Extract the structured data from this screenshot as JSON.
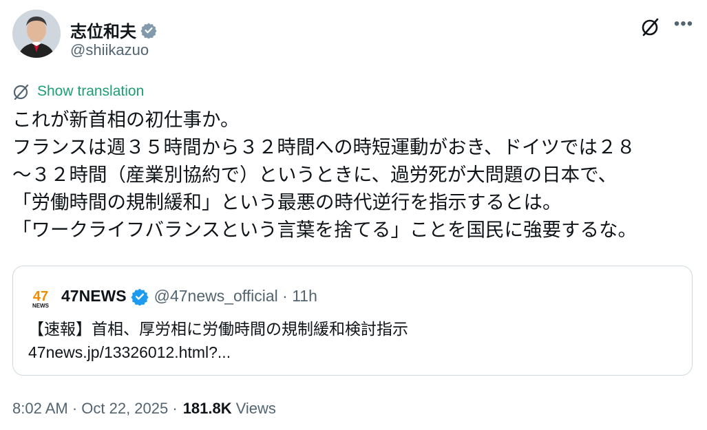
{
  "author": {
    "name": "志位和夫",
    "handle": "@shiikazuo"
  },
  "translate_label": "Show translation",
  "tweet_text": "これが新首相の初仕事か。\nフランスは週３５時間から３２時間への時短運動がおき、ドイツでは２８\n～３２時間（産業別協約で）というときに、過労死が大問題の日本で、\n「労働時間の規制緩和」という最悪の時代逆行を指示するとは。\n「ワークライフバランスという言葉を捨てる」ことを国民に強要するな。",
  "quote": {
    "logo_text": "47",
    "logo_sub": "NEWS",
    "name": "47NEWS",
    "handle_time": "@47news_official · 11h",
    "text": "【速報】首相、厚労相に労働時間の規制緩和検討指示",
    "link": "47news.jp/13326012.html?..."
  },
  "footer": {
    "time_date": "8:02 AM · Oct 22, 2025 ·",
    "views_count": "181.8K",
    "views_label": "Views"
  },
  "colors": {
    "verified_blue": "#1d9bf0",
    "verified_gray": "#829aab",
    "translate_green": "#1d9e74",
    "logo_orange": "#f08c00"
  },
  "icons": {
    "verified": "gray-verified-badge-icon",
    "grok": "grok-icon",
    "more": "more-icon",
    "translate": "translate-icon",
    "quote_verified": "blue-verified-badge-icon"
  }
}
